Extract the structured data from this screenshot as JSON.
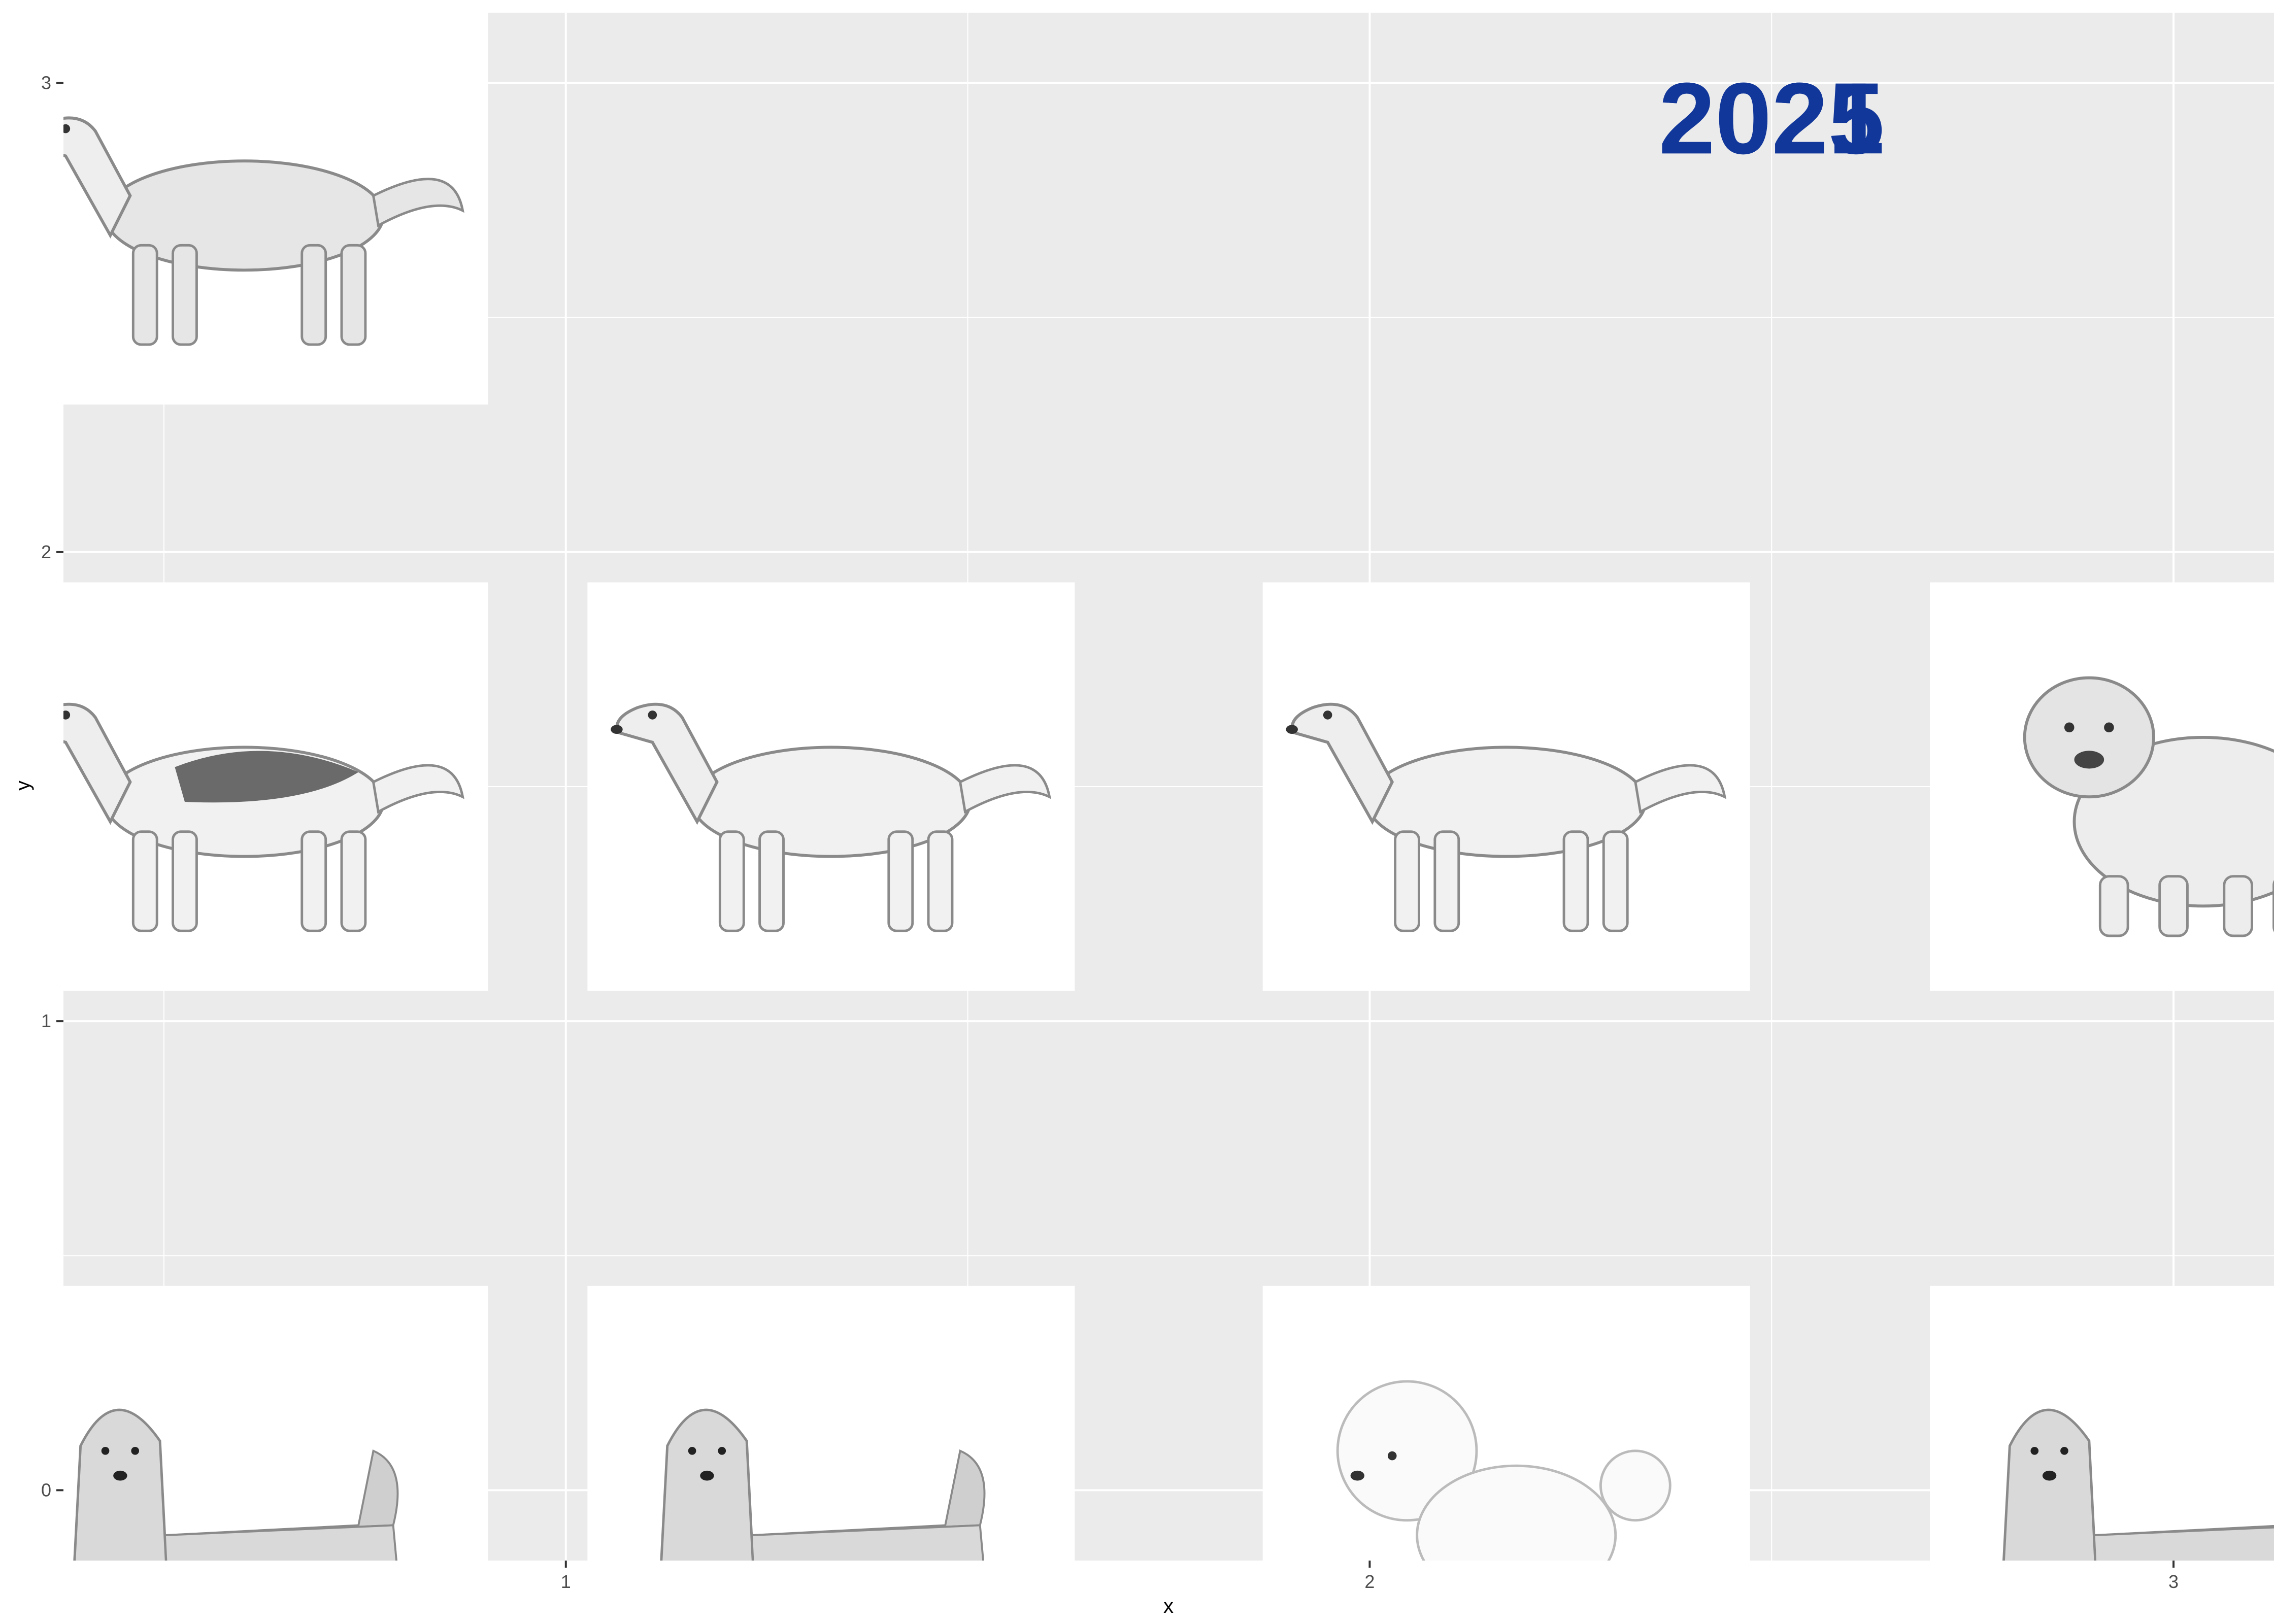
{
  "chart_data": {
    "type": "scatter",
    "title": "",
    "xlabel": "x",
    "ylabel": "y",
    "xlim": [
      0.375,
      3.125
    ],
    "ylim": [
      -0.15,
      3.15
    ],
    "x_ticks": [
      1,
      2,
      3
    ],
    "y_ticks": [
      0,
      1,
      2,
      3
    ],
    "x_tick_labels": [
      "1",
      "2",
      "3"
    ],
    "y_tick_labels": [
      "0",
      "1",
      "2",
      "3"
    ],
    "grid": true,
    "panel_background": "#ebebeb",
    "grid_color": "#ffffff",
    "annotation": {
      "text": "2025",
      "overlaid_text": "2021",
      "x": 2.5,
      "y": 2.85,
      "color": "#12379a"
    },
    "points": [
      {
        "x": 0.6,
        "y": 2.75,
        "breed": "labrador-retriever",
        "icon": "labrador-icon"
      },
      {
        "x": 0.6,
        "y": 1.5,
        "breed": "german-shepherd",
        "icon": "german-shepherd-icon"
      },
      {
        "x": 1.33,
        "y": 1.5,
        "breed": "golden-retriever",
        "icon": "golden-retriever-icon"
      },
      {
        "x": 2.17,
        "y": 1.5,
        "breed": "golden-retriever",
        "icon": "golden-retriever-icon"
      },
      {
        "x": 3.0,
        "y": 1.5,
        "breed": "bulldog",
        "icon": "bulldog-icon"
      },
      {
        "x": 0.6,
        "y": 0.0,
        "breed": "yorkshire-terrier",
        "icon": "yorkshire-terrier-icon"
      },
      {
        "x": 1.33,
        "y": 0.0,
        "breed": "yorkshire-terrier",
        "icon": "yorkshire-terrier-icon"
      },
      {
        "x": 2.17,
        "y": 0.0,
        "breed": "poodle",
        "icon": "poodle-icon"
      },
      {
        "x": 3.0,
        "y": 0.0,
        "breed": "yorkshire-terrier",
        "icon": "yorkshire-terrier-icon"
      }
    ]
  }
}
